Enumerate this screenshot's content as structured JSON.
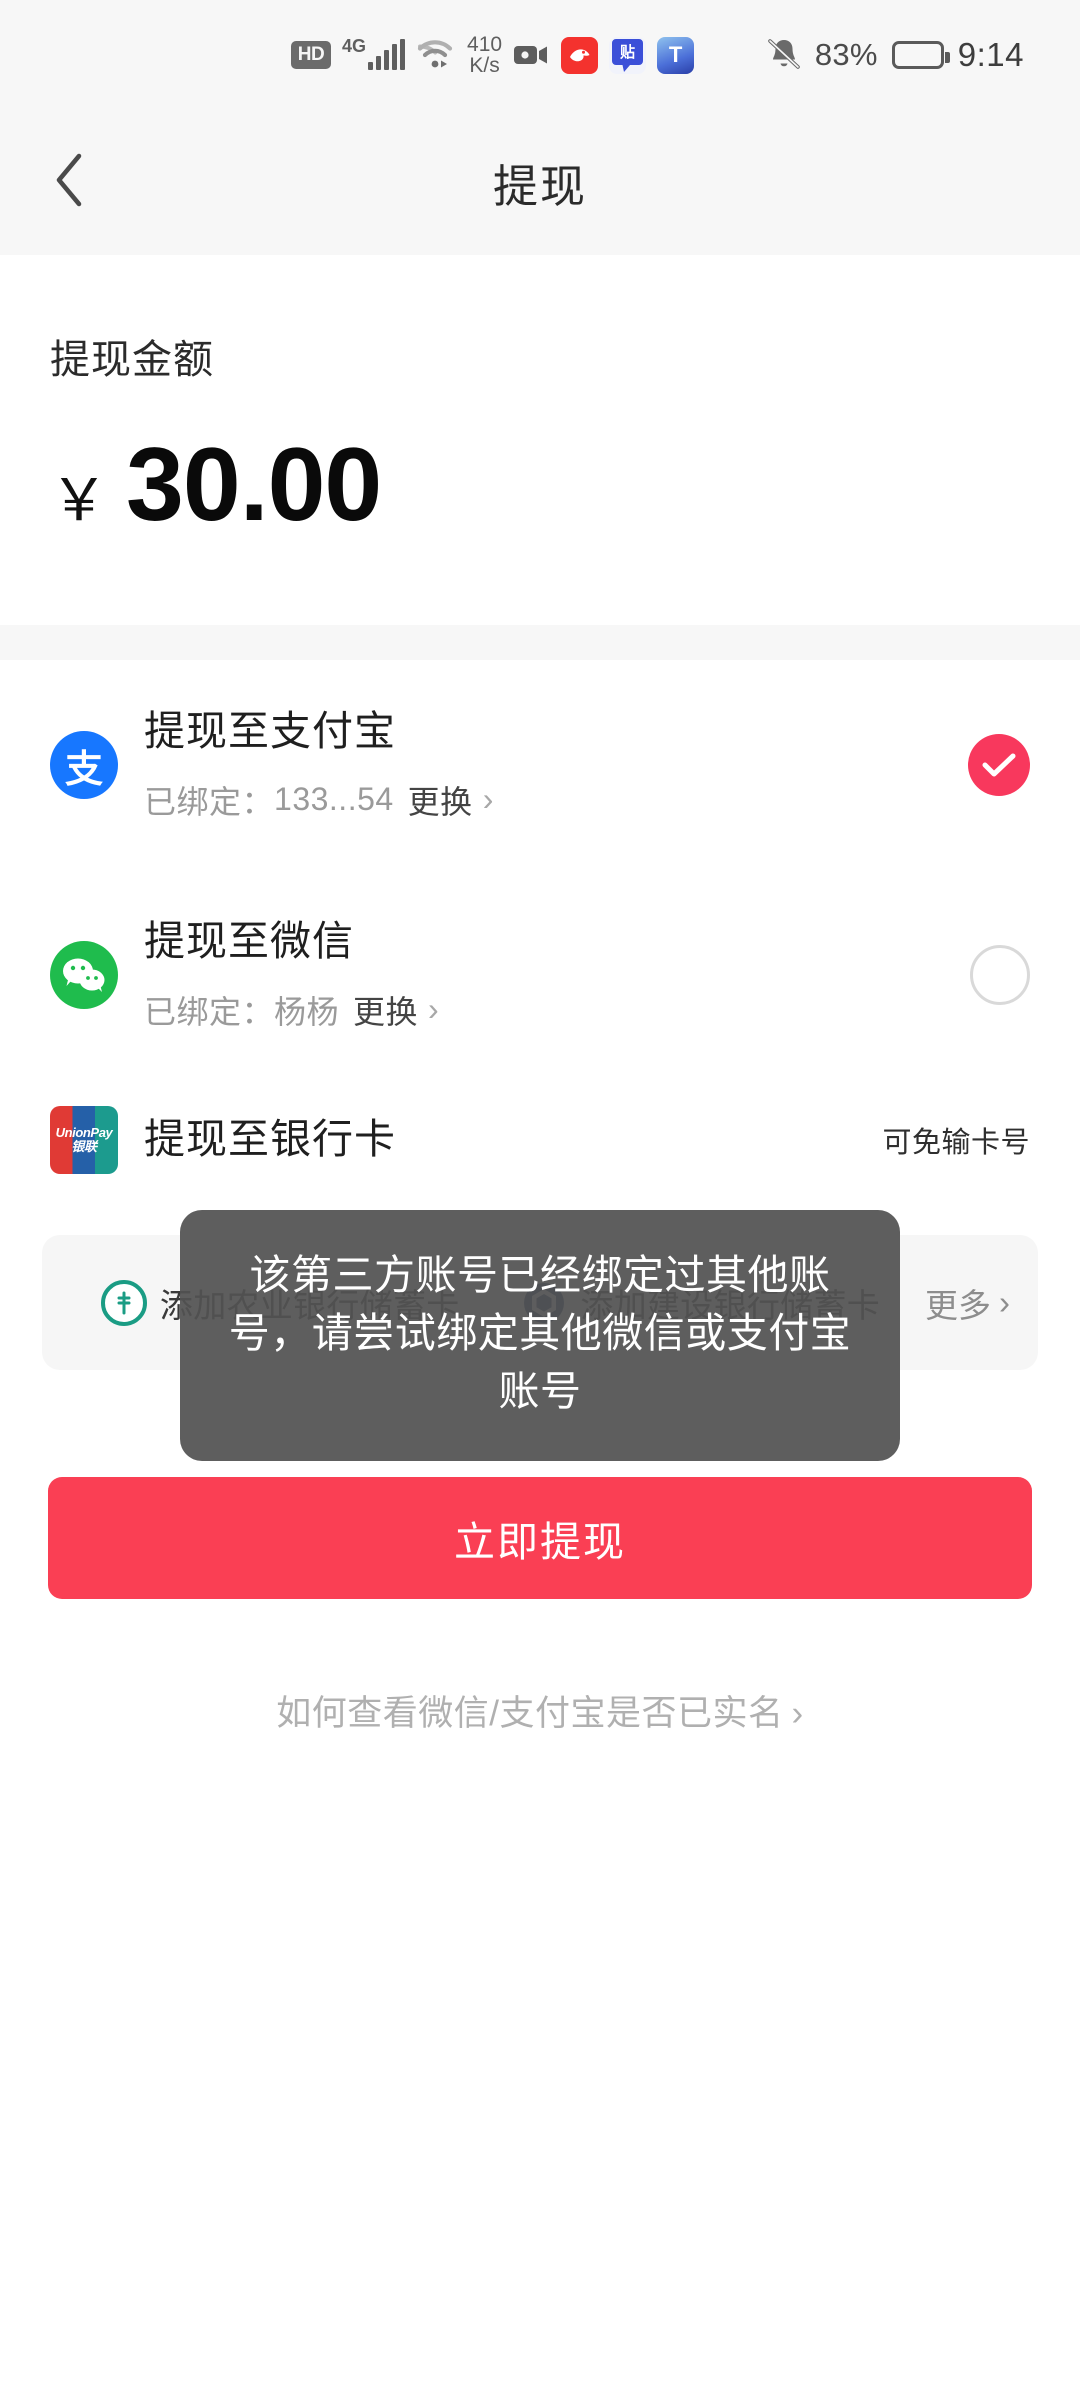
{
  "status_bar": {
    "hd_badge": "HD",
    "network_type": "4G",
    "net_speed_value": "410",
    "net_speed_unit": "K/s",
    "app_icons": [
      "video-recorder-icon",
      "red-app-icon",
      "tie-app-icon",
      "t-app-icon"
    ],
    "bell_icon": "bell-muted-icon",
    "battery_percent": "83%",
    "battery_icon": "battery-icon",
    "clock": "9:14"
  },
  "nav": {
    "back_icon": "chevron-left-icon",
    "title": "提现"
  },
  "amount": {
    "label": "提现金额",
    "currency_symbol": "￥",
    "value": "30.00"
  },
  "channels": [
    {
      "icon": "alipay-icon",
      "icon_glyph": "支",
      "title": "提现至支付宝",
      "bound_prefix": "已绑定：",
      "bound_value": "133...54",
      "change_label": "更换",
      "chevron": "›",
      "selected": true
    },
    {
      "icon": "wechat-icon",
      "title": "提现至微信",
      "bound_prefix": "已绑定：",
      "bound_value": "杨杨",
      "change_label": "更换",
      "chevron": "›",
      "selected": false
    }
  ],
  "bank_row": {
    "icon": "unionpay-icon",
    "icon_text_top": "UnionPay",
    "icon_text_bottom": "银联",
    "title": "提现至银行卡",
    "note": "可免输卡号"
  },
  "bank_quick": {
    "options": [
      {
        "logo": "abc-bank-logo",
        "label": "添加农业银行储蓄卡"
      },
      {
        "logo": "ccb-bank-logo",
        "label": "添加建设银行储蓄卡"
      }
    ],
    "more_label": "更多",
    "more_chevron": "›"
  },
  "cta": {
    "label": "立即提现"
  },
  "help": {
    "label": "如何查看微信/支付宝是否已实名",
    "chevron": "›"
  },
  "toast": {
    "message": "该第三方账号已经绑定过其他账号，请尝试绑定其他微信或支付宝账号"
  },
  "colors": {
    "accent_red": "#fa3f54",
    "selected_radio": "#f8385d",
    "alipay_blue": "#1777ff",
    "wechat_green": "#1fbc4d",
    "page_bg": "#ffffff",
    "strip_bg": "#f7f7f7"
  }
}
